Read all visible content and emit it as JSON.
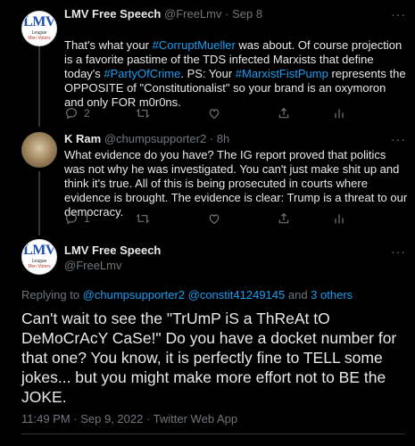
{
  "tweet1": {
    "name": "LMV Free Speech",
    "handle": "@FreeLmv",
    "separator": "·",
    "date": "Sep 8",
    "more": "···",
    "avatar_text": [
      "LMV",
      "League",
      "Men Voters"
    ],
    "segments": [
      {
        "t": "That's what your ",
        "link": false
      },
      {
        "t": "#CorruptMueller",
        "link": true
      },
      {
        "t": " was about.  Of course projection is a favorite pastime of the TDS infected Marxists that define today's ",
        "link": false
      },
      {
        "t": "#PartyOfCrime",
        "link": true
      },
      {
        "t": ".  PS: Your ",
        "link": false
      },
      {
        "t": "#MarxistFistPump",
        "link": true
      },
      {
        "t": " represents the OPPOSITE of \"Constitutionalist\" so your brand is an oxymoron and only FOR m0r0ns.",
        "link": false
      }
    ],
    "reply_count": "2"
  },
  "tweet2": {
    "name": "K Ram",
    "handle": "@chumpsupporter2",
    "separator": "·",
    "date": "8h",
    "more": "···",
    "text": "What evidence do you have? The IG report proved that politics was not why he was investigated. You can't just make shit up and think it's true. All of this is being prosecuted in courts where evidence is brought. The evidence is clear: Trump is a threat to our democracy.",
    "reply_count": "1"
  },
  "main": {
    "name": "LMV Free Speech",
    "handle": "@FreeLmv",
    "more": "···",
    "avatar_text": [
      "LMV",
      "League",
      "Men Voters"
    ],
    "replying_prefix": "Replying to ",
    "replying_users": "@chumpsupporter2 @constit41249145",
    "replying_suffix_and": " and ",
    "replying_others": "3 others",
    "text": "Can't wait to see the \"TrUmP iS a ThReAt tO DeMoCrAcY CaSe!\"  Do you have a docket number for that one?  You know, it is perfectly fine to TELL some jokes... but you might make more effort not to BE the JOKE.",
    "timestamp": "11:49 PM · Sep 9, 2022 · Twitter Web App"
  },
  "colors": {
    "background": "#000000",
    "text": "#e7e9ea",
    "muted": "#71767b",
    "accent": "#1d9bf0"
  },
  "icons": [
    "reply-icon",
    "retweet-icon",
    "like-icon",
    "share-icon",
    "analytics-icon",
    "more-icon"
  ]
}
